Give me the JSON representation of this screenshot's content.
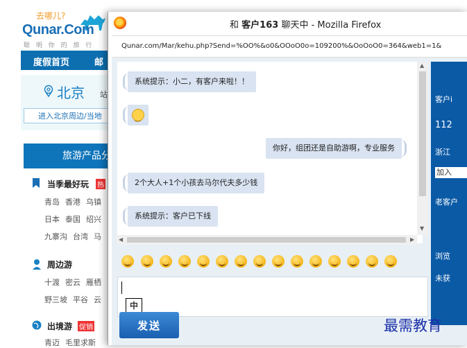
{
  "background": {
    "logo": {
      "slogan": "去哪儿?",
      "brand": "Qunar.Com",
      "sub": "聪 明 你 的 旅 行"
    },
    "nav": [
      "度假首页",
      "邮"
    ],
    "city": {
      "name": "北京",
      "switch": "站⌄"
    },
    "enter_button": "进入北京周边/当地",
    "section_title": "旅游产品分",
    "categories": [
      {
        "label": "当季最好玩",
        "badge": "热",
        "links": [
          [
            "青岛",
            "香港",
            "乌镇"
          ],
          [
            "日本",
            "泰国",
            "绍兴"
          ],
          [
            "九寨沟",
            "台湾",
            "马"
          ]
        ]
      },
      {
        "label": "周边游",
        "badge": "",
        "links": [
          [
            "十渡",
            "密云",
            "雁栖"
          ],
          [
            "野三坡",
            "平谷",
            "云"
          ]
        ]
      },
      {
        "label": "出境游",
        "badge": "促销",
        "links": [
          [
            "青迈",
            "毛里求斯"
          ]
        ]
      }
    ]
  },
  "window": {
    "title_prefix": "和",
    "title_customer": "客户163",
    "title_suffix": "聊天中 - Mozilla Firefox",
    "address": "Qunar.com/Mar/kehu.php?Send=%OO%&o0&OOoO0o=109200%&OoOoO0=364&web1=1&"
  },
  "chat": {
    "messages": [
      {
        "side": "left",
        "text": "系统提示：小二，有客户来啦！！"
      },
      {
        "side": "left",
        "text": "",
        "emoji": "smile-icon"
      },
      {
        "side": "right",
        "text": "你好，组团还是自助游啊，专业服务"
      },
      {
        "side": "left",
        "text": "2个大人+1个小孩去马尔代夫多少钱"
      },
      {
        "side": "left",
        "text": "系统提示：客户已下线"
      }
    ]
  },
  "info_panel": {
    "rows": [
      "客户i",
      "112",
      "浙江",
      "加入",
      "老客户",
      "浏览",
      "未获"
    ]
  },
  "emoji_bar": [
    "handshake-icon",
    "grin-icon",
    "cry-icon",
    "wink-icon",
    "think-icon",
    "smile-icon",
    "laugh-icon",
    "sad-icon",
    "blush-icon",
    "question-icon",
    "happy-icon",
    "smirk-icon",
    "worried-icon",
    "cool-icon",
    "shy-icon"
  ],
  "ime_label": "中",
  "send_button": "发送",
  "watermark": "最需教育",
  "colors": {
    "brand_blue": "#0d6fb0",
    "panel_blue": "#0b5aa6",
    "bubble": "#d9e3f1"
  }
}
